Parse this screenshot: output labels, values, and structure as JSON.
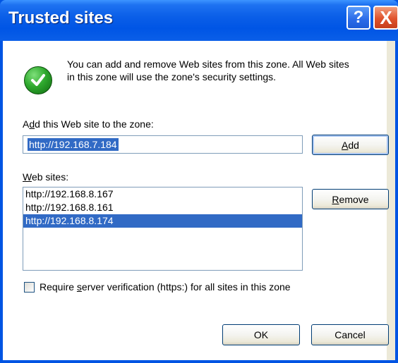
{
  "dialog": {
    "title": "Trusted sites",
    "help_button": "?",
    "close_button": "X"
  },
  "info": {
    "icon": "checkmark-icon",
    "line1": "You can add and remove Web sites from this zone. All Web sites",
    "line2": "in this zone will use the zone's security settings."
  },
  "add_site": {
    "label_pre": "A",
    "label_key": "d",
    "label_post": "d this Web site to the zone:",
    "input_value": "http://192.168.7.184",
    "add_button_key": "A",
    "add_button_rest": "dd"
  },
  "web_sites": {
    "label_key": "W",
    "label_rest": "eb sites:",
    "items": [
      "http://192.168.8.167",
      "http://192.168.8.161",
      "http://192.168.8.174"
    ],
    "selected_index": 2,
    "remove_button_key": "R",
    "remove_button_rest": "emove"
  },
  "require_verification": {
    "checked": false,
    "label_pre": "Require ",
    "label_key": "s",
    "label_post": "erver verification (https:) for all sites in this zone"
  },
  "footer": {
    "ok": "OK",
    "cancel": "Cancel"
  },
  "colors": {
    "title_bar": "#0055e5",
    "selection": "#316ac5",
    "close_button": "#e0522b",
    "icon_green": "#2fa92e"
  }
}
